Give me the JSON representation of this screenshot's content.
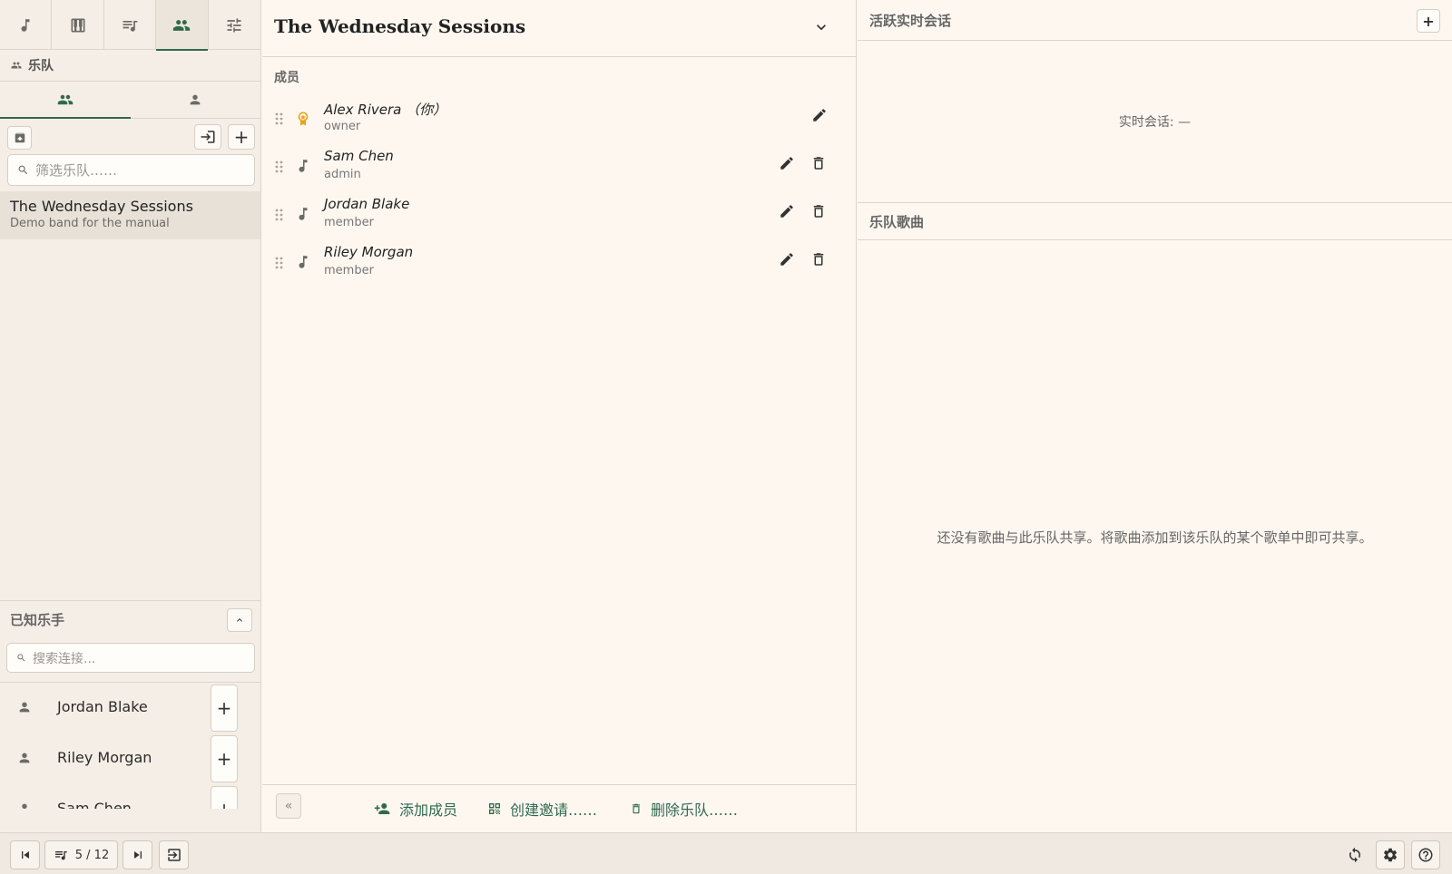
{
  "sidebar": {
    "top_tabs": [
      {
        "icon": "music-note-icon"
      },
      {
        "icon": "piano-icon"
      },
      {
        "icon": "playlist-icon"
      },
      {
        "icon": "groups-icon",
        "active": true
      },
      {
        "icon": "tune-icon"
      }
    ],
    "section_title": "乐队",
    "band_filter_placeholder": "筛选乐队……",
    "bands": [
      {
        "name": "The Wednesday Sessions",
        "description": "Demo band for the manual"
      }
    ],
    "known_musicians_title": "已知乐手",
    "connection_search_placeholder": "搜索连接...",
    "known_musicians": [
      {
        "name": "Jordan Blake"
      },
      {
        "name": "Riley Morgan"
      },
      {
        "name": "Sam Chen"
      }
    ]
  },
  "band_detail": {
    "title": "The Wednesday Sessions",
    "members_label": "成员",
    "members": [
      {
        "name": "Alex Rivera （你）",
        "role": "owner",
        "role_icon": "owner-badge-icon"
      },
      {
        "name": "Sam Chen",
        "role": "admin",
        "role_icon": "music-note-icon"
      },
      {
        "name": "Jordan Blake",
        "role": "member",
        "role_icon": "music-note-icon"
      },
      {
        "name": "Riley Morgan",
        "role": "member",
        "role_icon": "music-note-icon"
      }
    ],
    "footer": {
      "collapse": "«",
      "add_member": "添加成员",
      "create_invite": "创建邀请……",
      "delete_band": "删除乐队……"
    }
  },
  "right_panel": {
    "live_sessions_title": "活跃实时会话",
    "live_status": "实时会话: —",
    "band_songs_title": "乐队歌曲",
    "songs_empty": "还没有歌曲与此乐队共享。将歌曲添加到该乐队的某个歌单中即可共享。"
  },
  "bottom_bar": {
    "page_indicator": "5 / 12"
  },
  "colors": {
    "accent": "#2f6a4c",
    "owner_badge": "#e8a417",
    "background": "#fdf7f0",
    "sidebar_background": "#f5eee6"
  }
}
